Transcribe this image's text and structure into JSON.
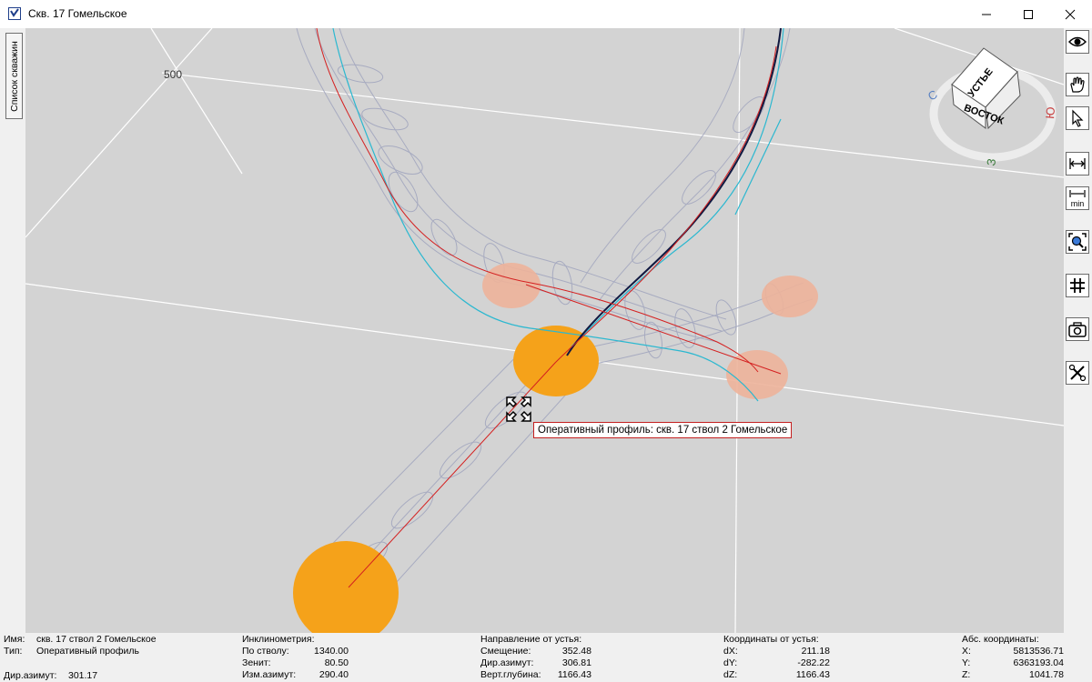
{
  "window": {
    "title": "Скв. 17 Гомельское"
  },
  "left_panel": {
    "wells_list_tab": "Список скважин"
  },
  "viewport": {
    "grid_label": "500",
    "cube": {
      "top_face": "УСТЬЕ",
      "front_face": "ВОСТОК"
    },
    "compass": {
      "north": "С",
      "south": "Ю",
      "west": "З"
    },
    "tooltip": "Оперативный профиль: скв. 17 ствол 2 Гомельское",
    "colors": {
      "background": "#d3d3d3",
      "operational_profile": "#d42020",
      "design_profile": "#2bb8d0",
      "actual_trajectory": "#101840",
      "target_circle_active": "#f5a21a",
      "target_circle_other": "#edb39a"
    }
  },
  "toolbar": {
    "icons": [
      "eye-icon",
      "hand-icon",
      "pointer-icon",
      "measure-icon",
      "measure-min-icon",
      "zoom-fit-icon",
      "grid-icon",
      "camera-icon",
      "tools-icon"
    ],
    "min_label": "min"
  },
  "status": {
    "name_label": "Имя:",
    "name_value": "скв. 17 ствол 2 Гомельское",
    "type_label": "Тип:",
    "type_value": "Оперативный профиль",
    "dir_azimuth_label": "Дир.азимут:",
    "dir_azimuth_value": "301.17",
    "inclinometry": {
      "header": "Инклинометрия:",
      "rows": [
        {
          "label": "По стволу:",
          "value": "1340.00"
        },
        {
          "label": "Зенит:",
          "value": "80.50"
        },
        {
          "label": "Изм.азимут:",
          "value": "290.40"
        }
      ]
    },
    "direction": {
      "header": "Направление от устья:",
      "rows": [
        {
          "label": "Смещение:",
          "value": "352.48"
        },
        {
          "label": "Дир.азимут:",
          "value": "306.81"
        },
        {
          "label": "Верт.глубина:",
          "value": "1166.43"
        }
      ]
    },
    "coords": {
      "header": "Координаты от устья:",
      "rows": [
        {
          "label": "dX:",
          "value": "211.18"
        },
        {
          "label": "dY:",
          "value": "-282.22"
        },
        {
          "label": "dZ:",
          "value": "1166.43"
        }
      ]
    },
    "abs": {
      "header": "Абс. координаты:",
      "rows": [
        {
          "label": "X:",
          "value": "5813536.71"
        },
        {
          "label": "Y:",
          "value": "6363193.04"
        },
        {
          "label": "Z:",
          "value": "1041.78"
        }
      ]
    }
  }
}
